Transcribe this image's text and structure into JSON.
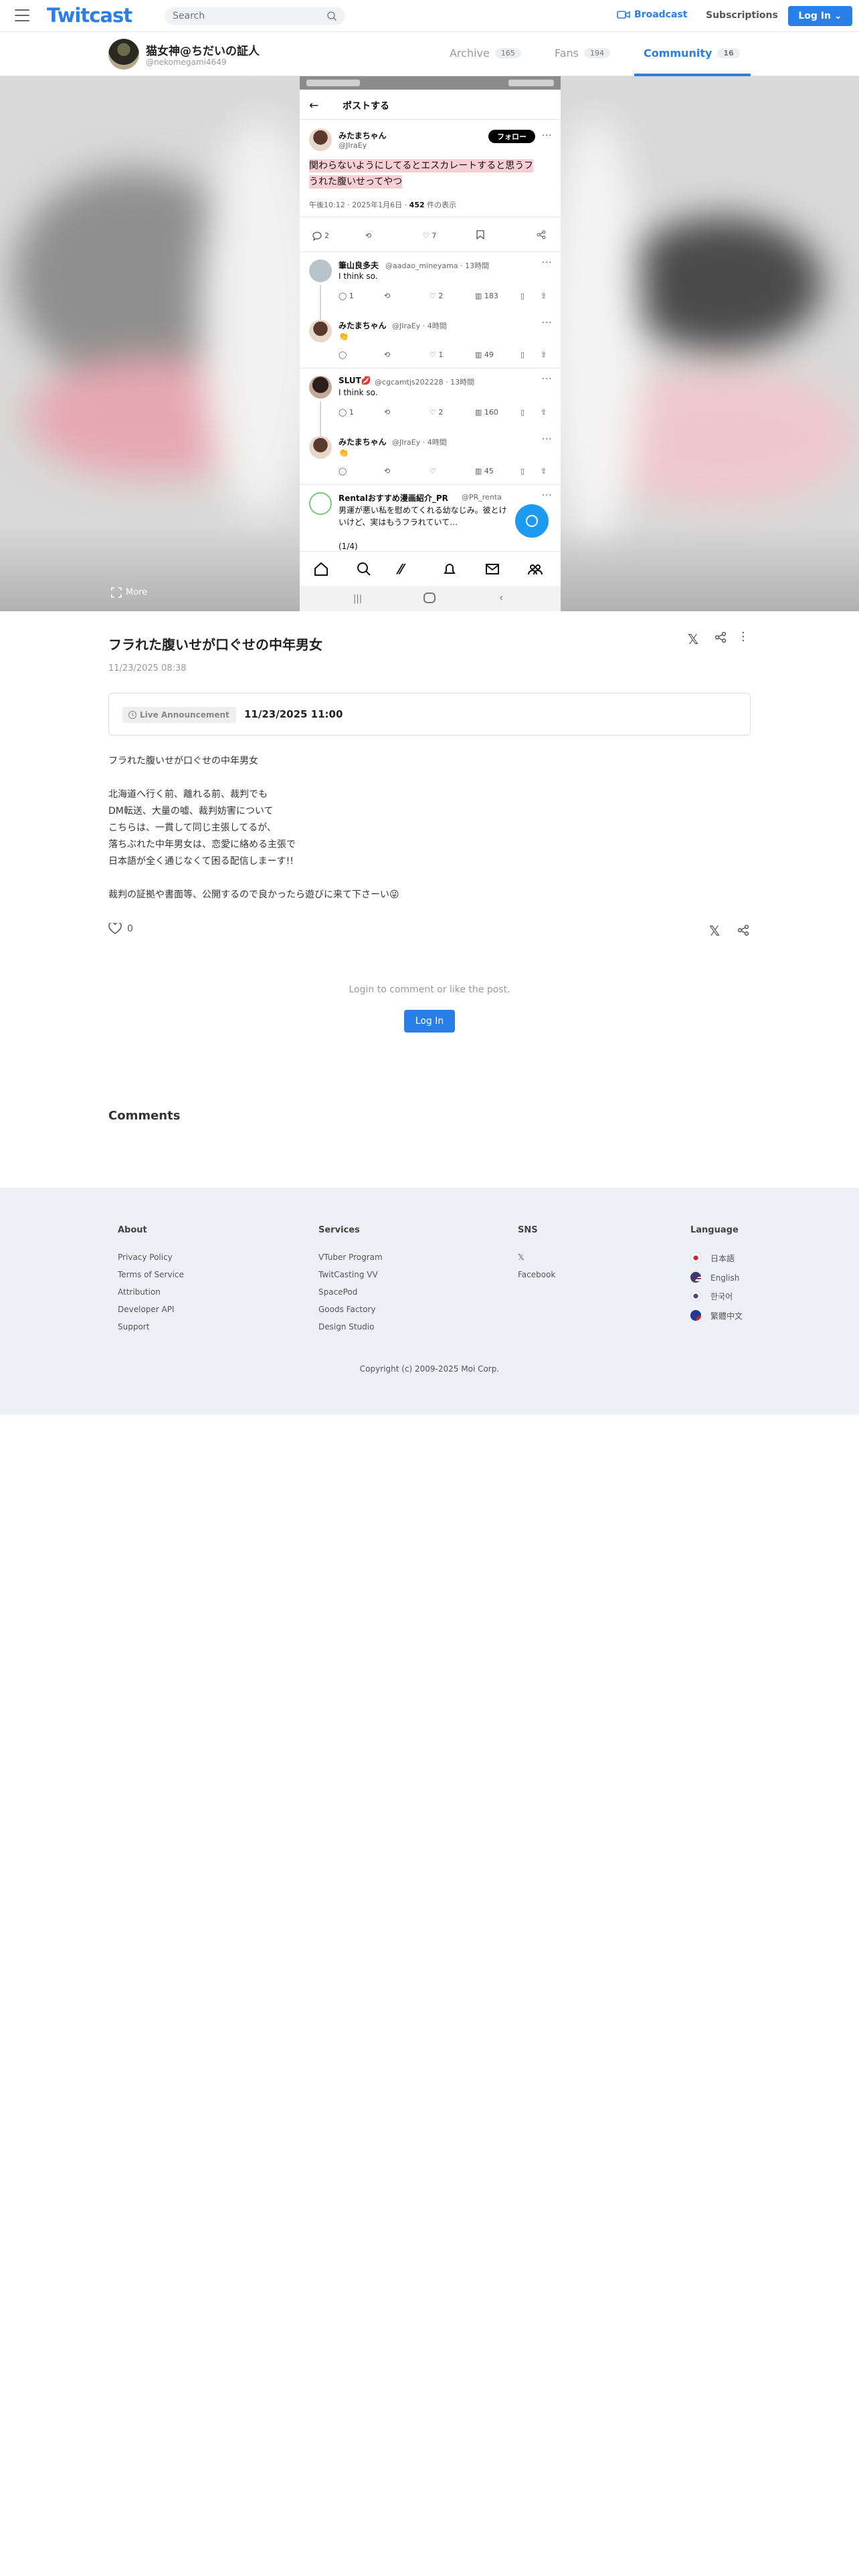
{
  "header": {
    "logo": "Twitcast",
    "search_placeholder": "Search",
    "broadcast": "Broadcast",
    "subscriptions": "Subscriptions",
    "login": "Log In"
  },
  "profile": {
    "name": "猫女神@ちだいの証人",
    "id": "@nekomegami4649",
    "tabs": [
      {
        "label": "Archive",
        "count": "165"
      },
      {
        "label": "Fans",
        "count": "194"
      },
      {
        "label": "Community",
        "count": "16"
      }
    ]
  },
  "hero": {
    "more": "More",
    "phone": {
      "title": "ポストする",
      "author_name": "みたまちゃん",
      "author_handle": "@JIraEy",
      "follow": "フォロー",
      "main_text_line1": "関わらないようにしてるとエスカレートすると思うフ",
      "main_text_line2": "うれた腹いせってやつ",
      "meta_prefix": "午後10:12 · 2025年1月6日 · ",
      "meta_views": "452",
      "meta_suffix": " 件の表示",
      "main_counts": {
        "reply": "2",
        "like": "7"
      },
      "replies": [
        {
          "name": "筆山良多夫",
          "handle": "@aadao_mineyama · 13時間",
          "text": "I think so.",
          "reply": "1",
          "like": "2",
          "views": "183"
        },
        {
          "name": "みたまちゃん",
          "handle": "@JIraEy · 4時間",
          "text": "👏",
          "reply": "",
          "like": "1",
          "views": "49"
        },
        {
          "name": "SLUT💋",
          "handle": "@cgcamtjs202228 · 13時間",
          "text": "I think so.",
          "reply": "1",
          "like": "2",
          "views": "160"
        },
        {
          "name": "みたまちゃん",
          "handle": "@JIraEy · 4時間",
          "text": "👏",
          "reply": "",
          "like": "",
          "views": "45"
        }
      ],
      "last": {
        "name": "Rentalおすすめ漫画紹介_PR",
        "handle": "@PR_renta",
        "text": "男運が悪い私を慰めてくれる幼なじみ。彼とけ",
        "text2": "いけど、実はもうフラれていて…",
        "text3": "(1/4)"
      }
    }
  },
  "post": {
    "title": "フラれた腹いせが口ぐせの中年男女",
    "date": "11/23/2025 08:38",
    "live_badge": "Live Announcement",
    "live_time": "11/23/2025 11:00",
    "body": [
      "フラれた腹いせが口ぐせの中年男女",
      "",
      "北海道へ行く前、離れる前、裁判でも",
      "DM転送、大量の嘘、裁判妨害について",
      "こちらは、一貫して同じ主張してるが、",
      "落ちぶれた中年男女は、恋愛に絡める主張で",
      "日本語が全く通じなくて困る配信しまーす!!",
      "",
      "裁判の証拠や書面等、公開するので良かったら遊びに来て下さーい😜"
    ],
    "likes": "0",
    "login_note": "Login to comment or like the post.",
    "login_button": "Log In",
    "comments_heading": "Comments"
  },
  "footer": {
    "about": {
      "title": "About",
      "links": [
        "Privacy Policy",
        "Terms of Service",
        "Attribution",
        "Developer API",
        "Support"
      ]
    },
    "services": {
      "title": "Services",
      "links": [
        "VTuber Program",
        "TwitCasting VV",
        "SpacePod",
        "Goods Factory",
        "Design Studio"
      ]
    },
    "sns": {
      "title": "SNS",
      "links": [
        "𝕏",
        "Facebook"
      ]
    },
    "language": {
      "title": "Language",
      "links": [
        "日本語",
        "English",
        "한국어",
        "繁體中文"
      ]
    },
    "copyright": "Copyright (c) 2009-2025 Moi Corp."
  },
  "colors": {
    "accent": "#2a7fe6",
    "footer_bg": "#eef0f5",
    "highlight": "#f7cfd5"
  }
}
